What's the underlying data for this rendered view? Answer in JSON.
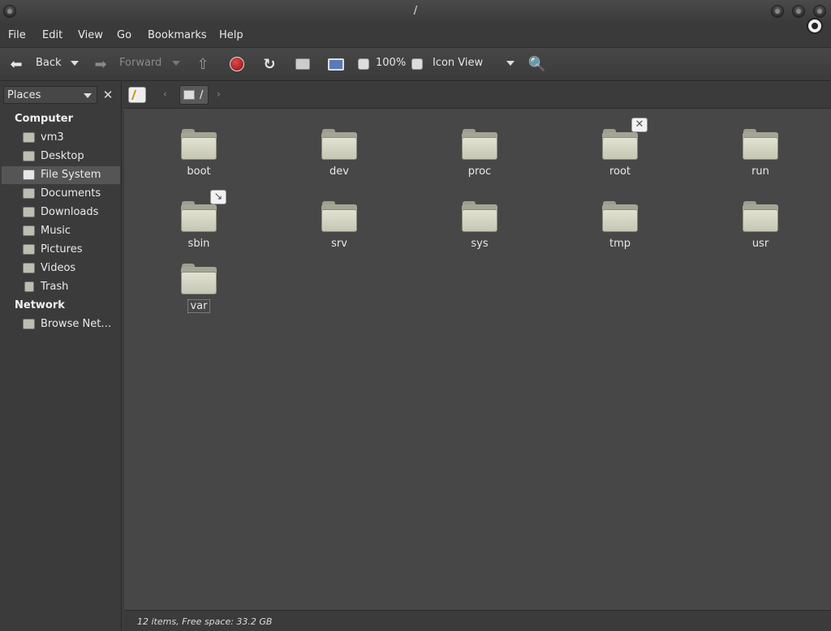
{
  "window": {
    "title": "/"
  },
  "menubar": {
    "items": [
      "File",
      "Edit",
      "View",
      "Go",
      "Bookmarks",
      "Help"
    ]
  },
  "toolbar": {
    "back_label": "Back",
    "forward_label": "Forward",
    "zoom_level": "100%",
    "view_mode": "Icon View"
  },
  "sidepane": {
    "selector_label": "Places",
    "sections": {
      "computer": "Computer",
      "network": "Network"
    },
    "computer_items": [
      "vm3",
      "Desktop",
      "File System",
      "Documents",
      "Downloads",
      "Music",
      "Pictures",
      "Videos",
      "Trash"
    ],
    "network_items": [
      "Browse Net…"
    ],
    "selected": "File System"
  },
  "location": {
    "crumb": "/"
  },
  "files": [
    "boot",
    "dev",
    "proc",
    "root",
    "run",
    "sbin",
    "srv",
    "sys",
    "tmp",
    "usr",
    "var"
  ],
  "emblems": {
    "root": "locked-icon",
    "sbin": "symlink-icon"
  },
  "statusbar": {
    "text": "12 items, Free space: 33.2 GB"
  },
  "colors": {
    "background": "#474747",
    "panel": "#3b3b3b",
    "selection": "#555555",
    "stop": "#c02020"
  }
}
